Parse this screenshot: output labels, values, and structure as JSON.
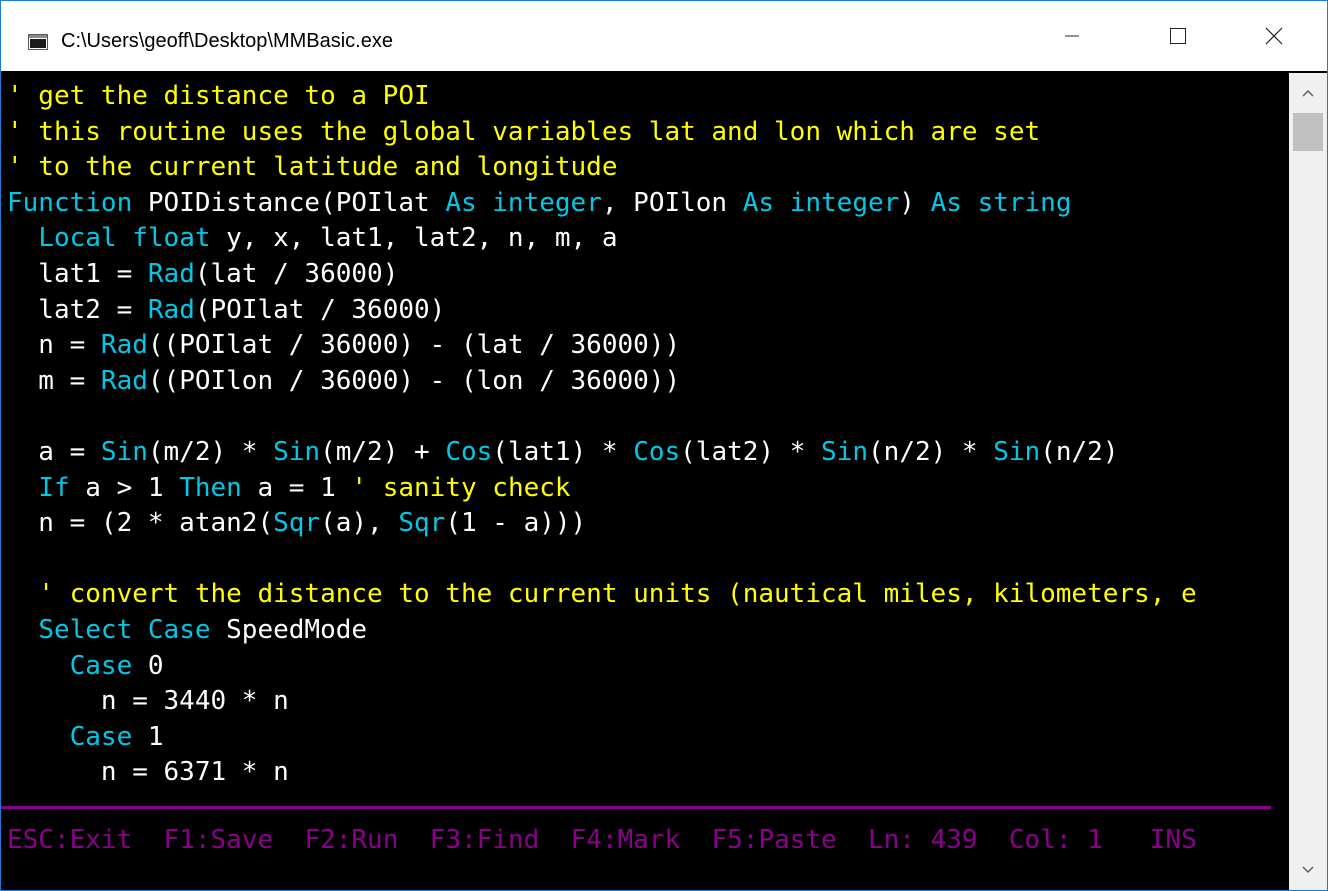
{
  "window": {
    "title": "C:\\Users\\geoff\\Desktop\\MMBasic.exe",
    "icon": "console-app-icon",
    "controls": [
      "minimize-icon",
      "maximize-icon",
      "close-icon"
    ]
  },
  "colors": {
    "comment": "#ffff00",
    "keyword": "#00c8e6",
    "text": "#ffffff",
    "status": "#8b008b",
    "background": "#000000"
  },
  "code_lines": [
    [
      {
        "t": "c",
        "v": "' get the distance to a POI"
      }
    ],
    [
      {
        "t": "c",
        "v": "' this routine uses the global variables lat and lon which are set"
      }
    ],
    [
      {
        "t": "c",
        "v": "' to the current latitude and longitude"
      }
    ],
    [
      {
        "t": "k",
        "v": "Function"
      },
      {
        "t": "w",
        "v": " POIDistance(POIlat "
      },
      {
        "t": "k",
        "v": "As integer"
      },
      {
        "t": "w",
        "v": ", POIlon "
      },
      {
        "t": "k",
        "v": "As integer"
      },
      {
        "t": "w",
        "v": ") "
      },
      {
        "t": "k",
        "v": "As string"
      }
    ],
    [
      {
        "t": "w",
        "v": "  "
      },
      {
        "t": "k",
        "v": "Local float"
      },
      {
        "t": "w",
        "v": " y, x, lat1, lat2, n, m, a"
      }
    ],
    [
      {
        "t": "w",
        "v": "  lat1 = "
      },
      {
        "t": "k",
        "v": "Rad"
      },
      {
        "t": "w",
        "v": "(lat / 36000)"
      }
    ],
    [
      {
        "t": "w",
        "v": "  lat2 = "
      },
      {
        "t": "k",
        "v": "Rad"
      },
      {
        "t": "w",
        "v": "(POIlat / 36000)"
      }
    ],
    [
      {
        "t": "w",
        "v": "  n = "
      },
      {
        "t": "k",
        "v": "Rad"
      },
      {
        "t": "w",
        "v": "((POIlat / 36000) - (lat / 36000))"
      }
    ],
    [
      {
        "t": "w",
        "v": "  m = "
      },
      {
        "t": "k",
        "v": "Rad"
      },
      {
        "t": "w",
        "v": "((POIlon / 36000) - (lon / 36000))"
      }
    ],
    [],
    [
      {
        "t": "w",
        "v": "  a = "
      },
      {
        "t": "k",
        "v": "Sin"
      },
      {
        "t": "w",
        "v": "(m/2) * "
      },
      {
        "t": "k",
        "v": "Sin"
      },
      {
        "t": "w",
        "v": "(m/2) + "
      },
      {
        "t": "k",
        "v": "Cos"
      },
      {
        "t": "w",
        "v": "(lat1) * "
      },
      {
        "t": "k",
        "v": "Cos"
      },
      {
        "t": "w",
        "v": "(lat2) * "
      },
      {
        "t": "k",
        "v": "Sin"
      },
      {
        "t": "w",
        "v": "(n/2) * "
      },
      {
        "t": "k",
        "v": "Sin"
      },
      {
        "t": "w",
        "v": "(n/2)"
      }
    ],
    [
      {
        "t": "w",
        "v": "  "
      },
      {
        "t": "k",
        "v": "If"
      },
      {
        "t": "w",
        "v": " a > 1 "
      },
      {
        "t": "k",
        "v": "Then"
      },
      {
        "t": "w",
        "v": " a = 1 "
      },
      {
        "t": "c",
        "v": "' sanity check"
      }
    ],
    [
      {
        "t": "w",
        "v": "  n = (2 * atan2("
      },
      {
        "t": "k",
        "v": "Sqr"
      },
      {
        "t": "w",
        "v": "(a), "
      },
      {
        "t": "k",
        "v": "Sqr"
      },
      {
        "t": "w",
        "v": "(1 - a)))"
      }
    ],
    [],
    [
      {
        "t": "c",
        "v": "  ' convert the distance to the current units (nautical miles, kilometers, e"
      }
    ],
    [
      {
        "t": "w",
        "v": "  "
      },
      {
        "t": "k",
        "v": "Select Case"
      },
      {
        "t": "w",
        "v": " SpeedMode"
      }
    ],
    [
      {
        "t": "w",
        "v": "    "
      },
      {
        "t": "k",
        "v": "Case"
      },
      {
        "t": "w",
        "v": " 0"
      }
    ],
    [
      {
        "t": "w",
        "v": "      n = 3440 * n"
      }
    ],
    [
      {
        "t": "w",
        "v": "    "
      },
      {
        "t": "k",
        "v": "Case"
      },
      {
        "t": "w",
        "v": " 1"
      }
    ],
    [
      {
        "t": "w",
        "v": "      n = 6371 * n"
      }
    ]
  ],
  "status": {
    "esc": "ESC:Exit",
    "f1": "F1:Save",
    "f2": "F2:Run",
    "f3": "F3:Find",
    "f4": "F4:Mark",
    "f5": "F5:Paste",
    "ln": "Ln: 439",
    "col": "Col: 1",
    "mode": "INS"
  },
  "scrollbar": {
    "up": "chevron-up-icon",
    "down": "chevron-down-icon"
  }
}
